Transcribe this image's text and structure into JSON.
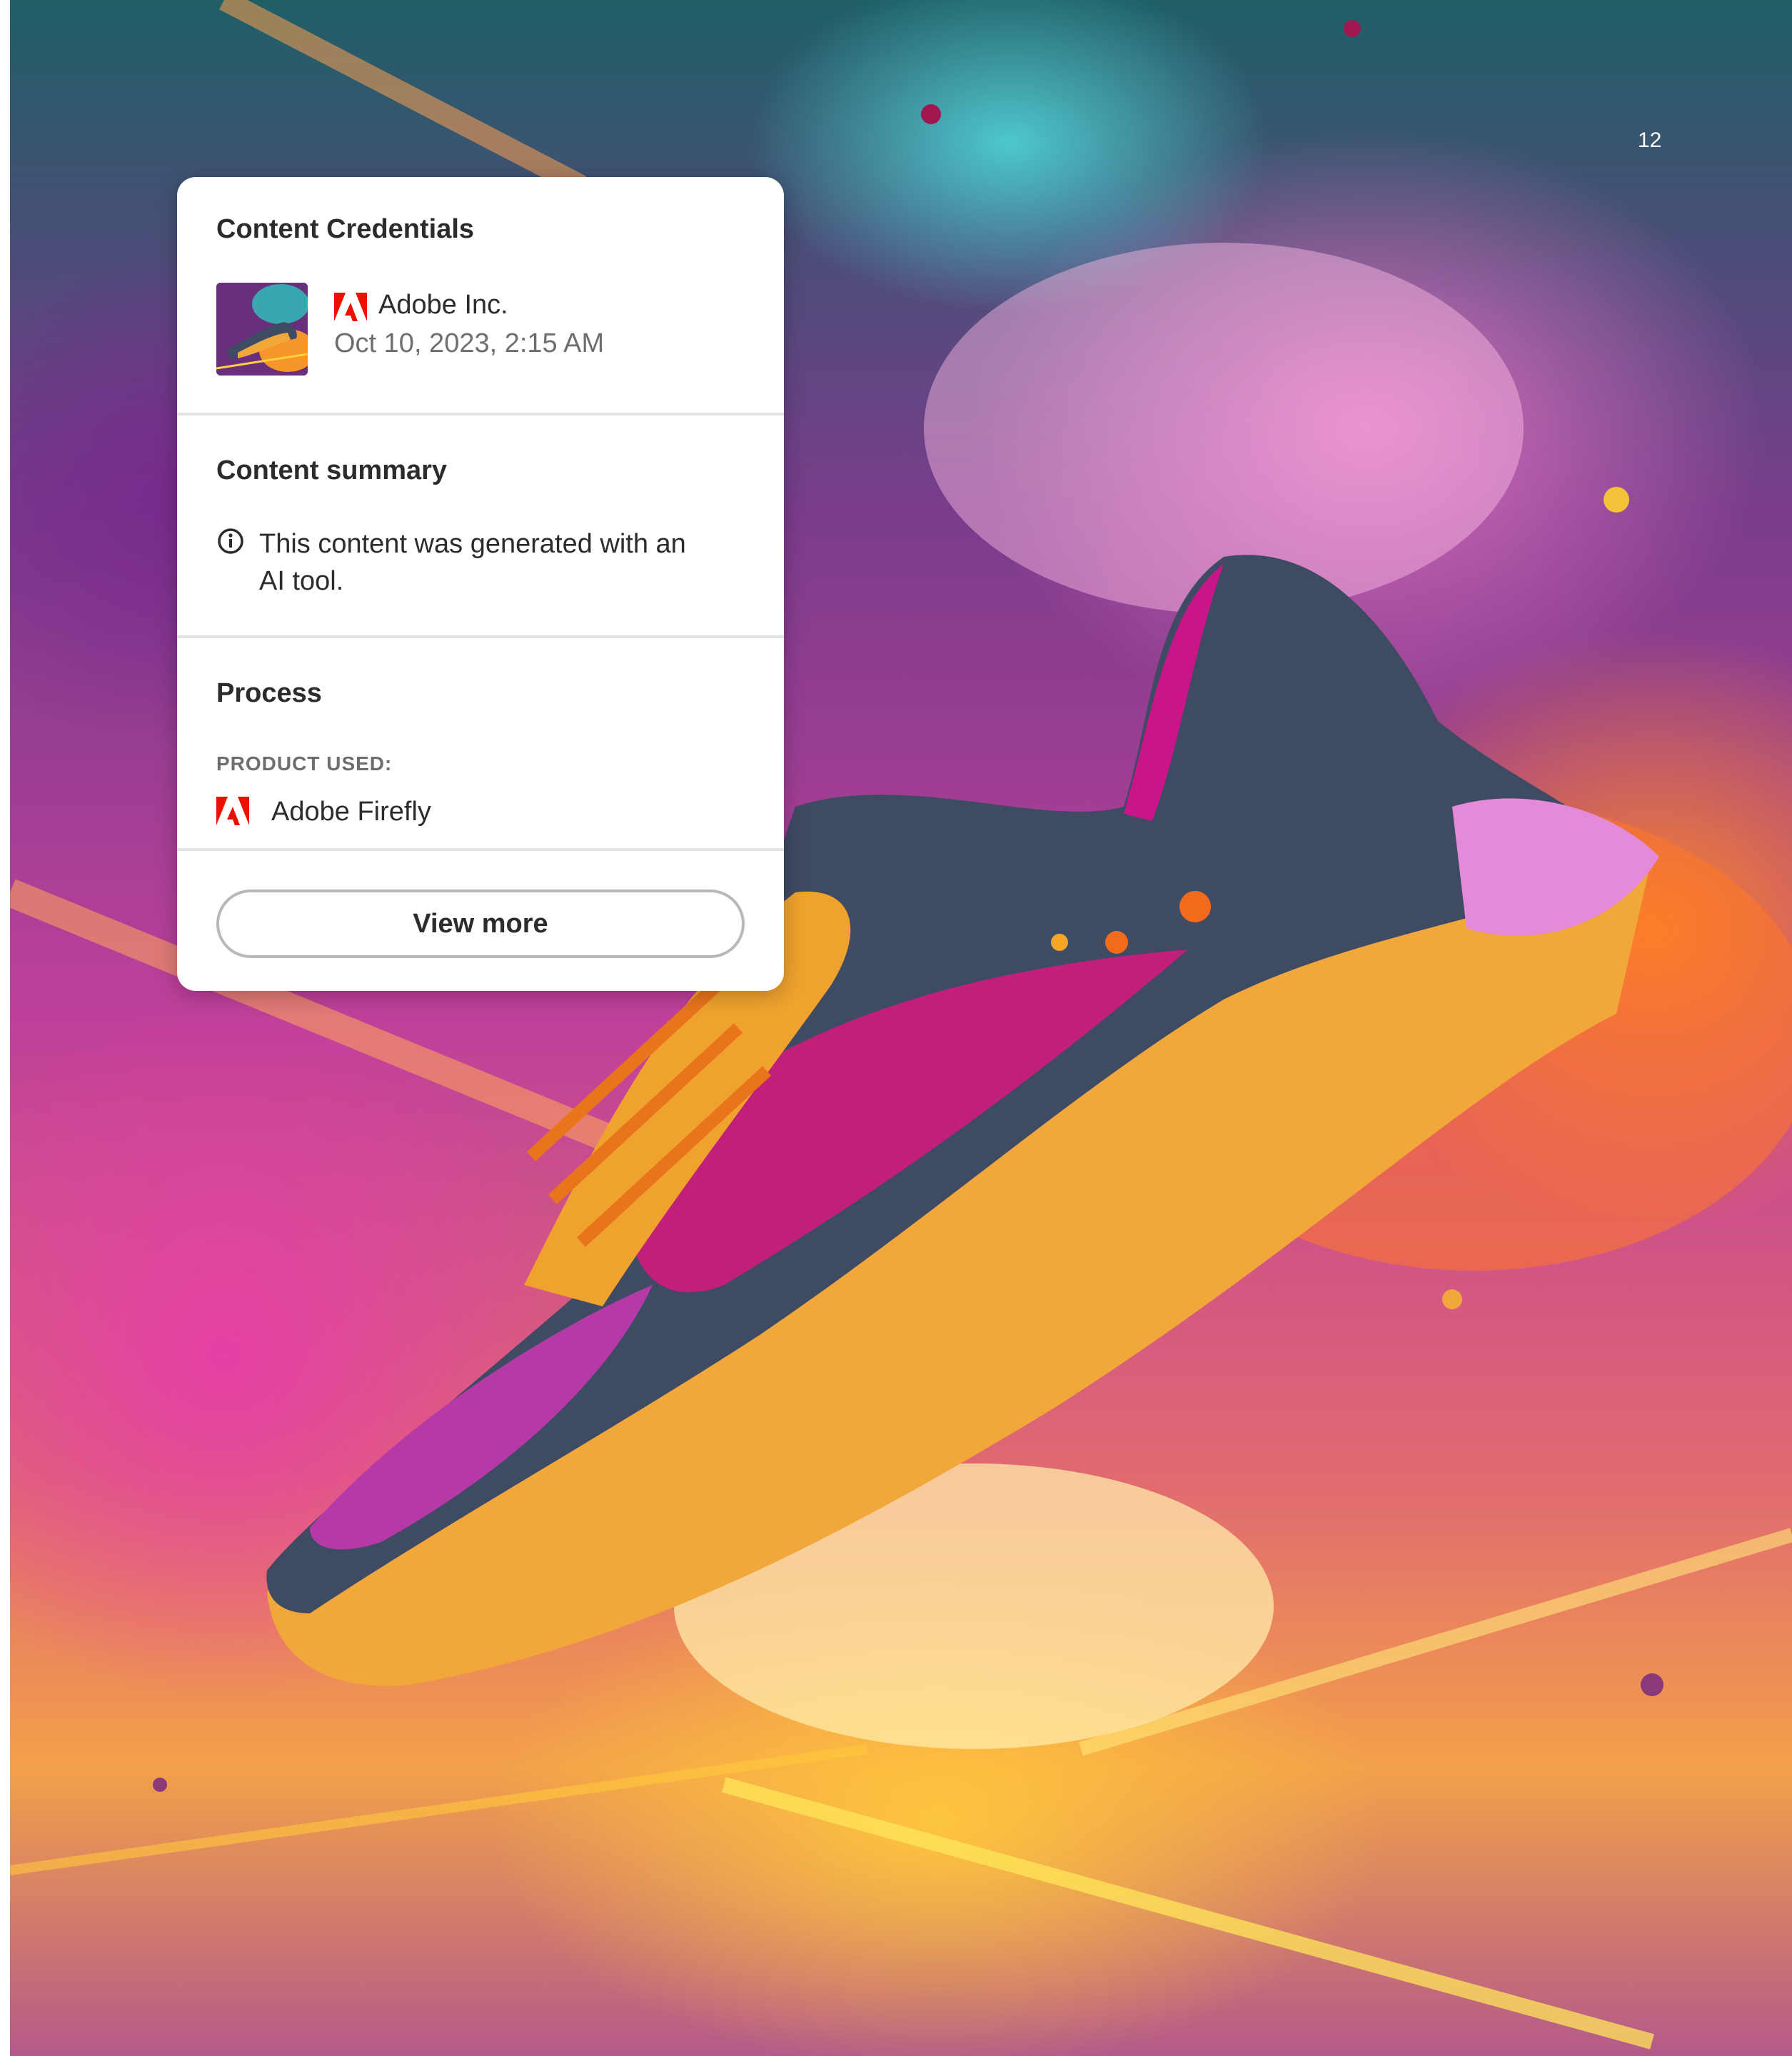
{
  "page": {
    "page_number": "12"
  },
  "credentials_panel": {
    "title": "Content Credentials",
    "issuer": "Adobe Inc.",
    "timestamp": "Oct 10, 2023, 2:15 AM",
    "icons": {
      "issuer_logo": "adobe-logo-icon",
      "thumbnail": "shoe-thumbnail",
      "info": "info-icon",
      "product_logo": "adobe-logo-icon"
    },
    "summary": {
      "heading": "Content summary",
      "text": "This content was generated with an AI tool."
    },
    "process": {
      "heading": "Process",
      "product_label": "PRODUCT USED:",
      "product_name": "Adobe Firefly"
    },
    "view_more_label": "View more"
  },
  "colors": {
    "adobe_red": "#eb1000",
    "panel_bg": "#ffffff",
    "text_primary": "#2c2c2c",
    "text_secondary": "#6e6e6e"
  }
}
